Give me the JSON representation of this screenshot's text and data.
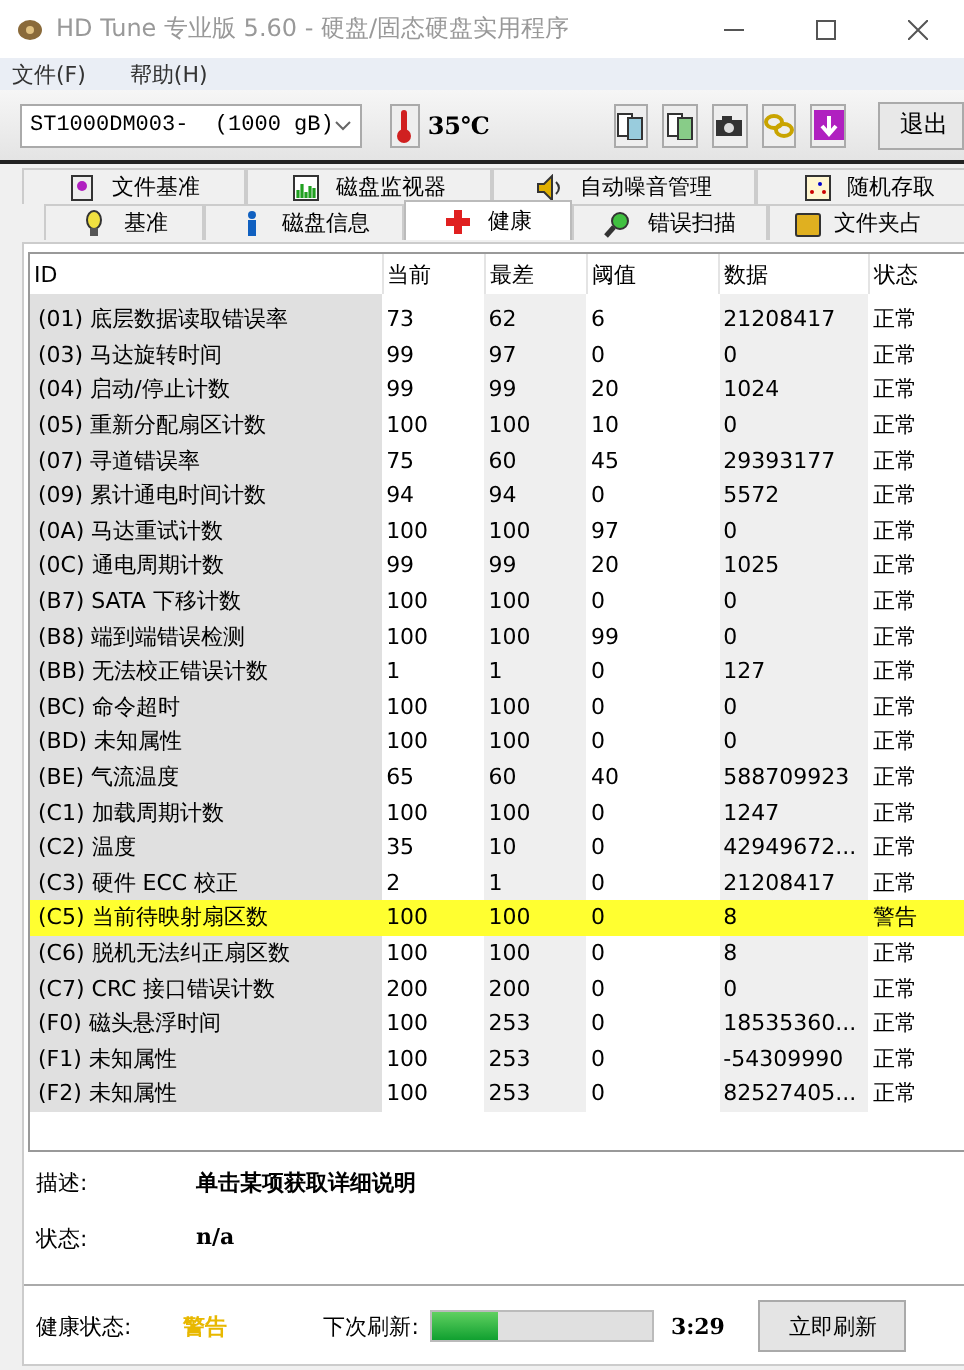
{
  "window": {
    "title": "HD Tune 专业版 5.60 - 硬盘/固态硬盘实用程序"
  },
  "menu": [
    "文件(F)",
    "帮助(H)"
  ],
  "toolbar": {
    "drive": "ST1000DM003-  (1000 gB)",
    "temperature": "35℃",
    "exit_button": "退出"
  },
  "tabs_back": [
    {
      "label": "文件基准",
      "selected": false
    },
    {
      "label": "磁盘监视器",
      "selected": false
    },
    {
      "label": "自动噪音管理",
      "selected": false
    },
    {
      "label": "随机存取",
      "selected": false
    }
  ],
  "tabs_front": [
    {
      "label": "基准",
      "selected": false
    },
    {
      "label": "磁盘信息",
      "selected": false
    },
    {
      "label": "健康",
      "selected": true
    },
    {
      "label": "错误扫描",
      "selected": false
    },
    {
      "label": "文件夹占",
      "selected": false
    }
  ],
  "table": {
    "columns": [
      "ID",
      "当前",
      "最差",
      "阈值",
      "数据",
      "状态"
    ],
    "rows": [
      {
        "cells": [
          "(01) 底层数据读取错误率",
          "73",
          "62",
          "6",
          "21208417",
          "正常"
        ],
        "warning": false
      },
      {
        "cells": [
          "(03) 马达旋转时间",
          "99",
          "97",
          "0",
          "0",
          "正常"
        ],
        "warning": false
      },
      {
        "cells": [
          "(04) 启动/停止计数",
          "99",
          "99",
          "20",
          "1024",
          "正常"
        ],
        "warning": false
      },
      {
        "cells": [
          "(05) 重新分配扇区计数",
          "100",
          "100",
          "10",
          "0",
          "正常"
        ],
        "warning": false
      },
      {
        "cells": [
          "(07) 寻道错误率",
          "75",
          "60",
          "45",
          "29393177",
          "正常"
        ],
        "warning": false
      },
      {
        "cells": [
          "(09) 累计通电时间计数",
          "94",
          "94",
          "0",
          "5572",
          "正常"
        ],
        "warning": false
      },
      {
        "cells": [
          "(0A) 马达重试计数",
          "100",
          "100",
          "97",
          "0",
          "正常"
        ],
        "warning": false
      },
      {
        "cells": [
          "(0C) 通电周期计数",
          "99",
          "99",
          "20",
          "1025",
          "正常"
        ],
        "warning": false
      },
      {
        "cells": [
          "(B7) SATA 下移计数",
          "100",
          "100",
          "0",
          "0",
          "正常"
        ],
        "warning": false
      },
      {
        "cells": [
          "(B8) 端到端错误检测",
          "100",
          "100",
          "99",
          "0",
          "正常"
        ],
        "warning": false
      },
      {
        "cells": [
          "(BB) 无法校正错误计数",
          "1",
          "1",
          "0",
          "127",
          "正常"
        ],
        "warning": false
      },
      {
        "cells": [
          "(BC) 命令超时",
          "100",
          "100",
          "0",
          "0",
          "正常"
        ],
        "warning": false
      },
      {
        "cells": [
          "(BD) 未知属性",
          "100",
          "100",
          "0",
          "0",
          "正常"
        ],
        "warning": false
      },
      {
        "cells": [
          "(BE) 气流温度",
          "65",
          "60",
          "40",
          "588709923",
          "正常"
        ],
        "warning": false
      },
      {
        "cells": [
          "(C1) 加载周期计数",
          "100",
          "100",
          "0",
          "1247",
          "正常"
        ],
        "warning": false
      },
      {
        "cells": [
          "(C2) 温度",
          "35",
          "10",
          "0",
          "42949672...",
          "正常"
        ],
        "warning": false
      },
      {
        "cells": [
          "(C3) 硬件 ECC 校正",
          "2",
          "1",
          "0",
          "21208417",
          "正常"
        ],
        "warning": false
      },
      {
        "cells": [
          "(C5) 当前待映射扇区数",
          "100",
          "100",
          "0",
          "8",
          "警告"
        ],
        "warning": true
      },
      {
        "cells": [
          "(C6) 脱机无法纠正扇区数",
          "100",
          "100",
          "0",
          "8",
          "正常"
        ],
        "warning": false
      },
      {
        "cells": [
          "(C7) CRC 接口错误计数",
          "200",
          "200",
          "0",
          "0",
          "正常"
        ],
        "warning": false
      },
      {
        "cells": [
          "(F0) 磁头悬浮时间",
          "100",
          "253",
          "0",
          "18535360...",
          "正常"
        ],
        "warning": false
      },
      {
        "cells": [
          "(F1) 未知属性",
          "100",
          "253",
          "0",
          "-54309990",
          "正常"
        ],
        "warning": false
      },
      {
        "cells": [
          "(F2) 未知属性",
          "100",
          "253",
          "0",
          "82527405...",
          "正常"
        ],
        "warning": false
      }
    ]
  },
  "details": [
    {
      "label": "描述:",
      "value": "单击某项获取详细说明"
    },
    {
      "label": "状态:",
      "value": "n/a"
    }
  ],
  "footer": {
    "health_label": "健康状态:",
    "health_value": "警告",
    "refresh_label": "下次刷新:",
    "level": 0.3,
    "countdown": "3:29",
    "refresh_button": "立即刷新"
  }
}
